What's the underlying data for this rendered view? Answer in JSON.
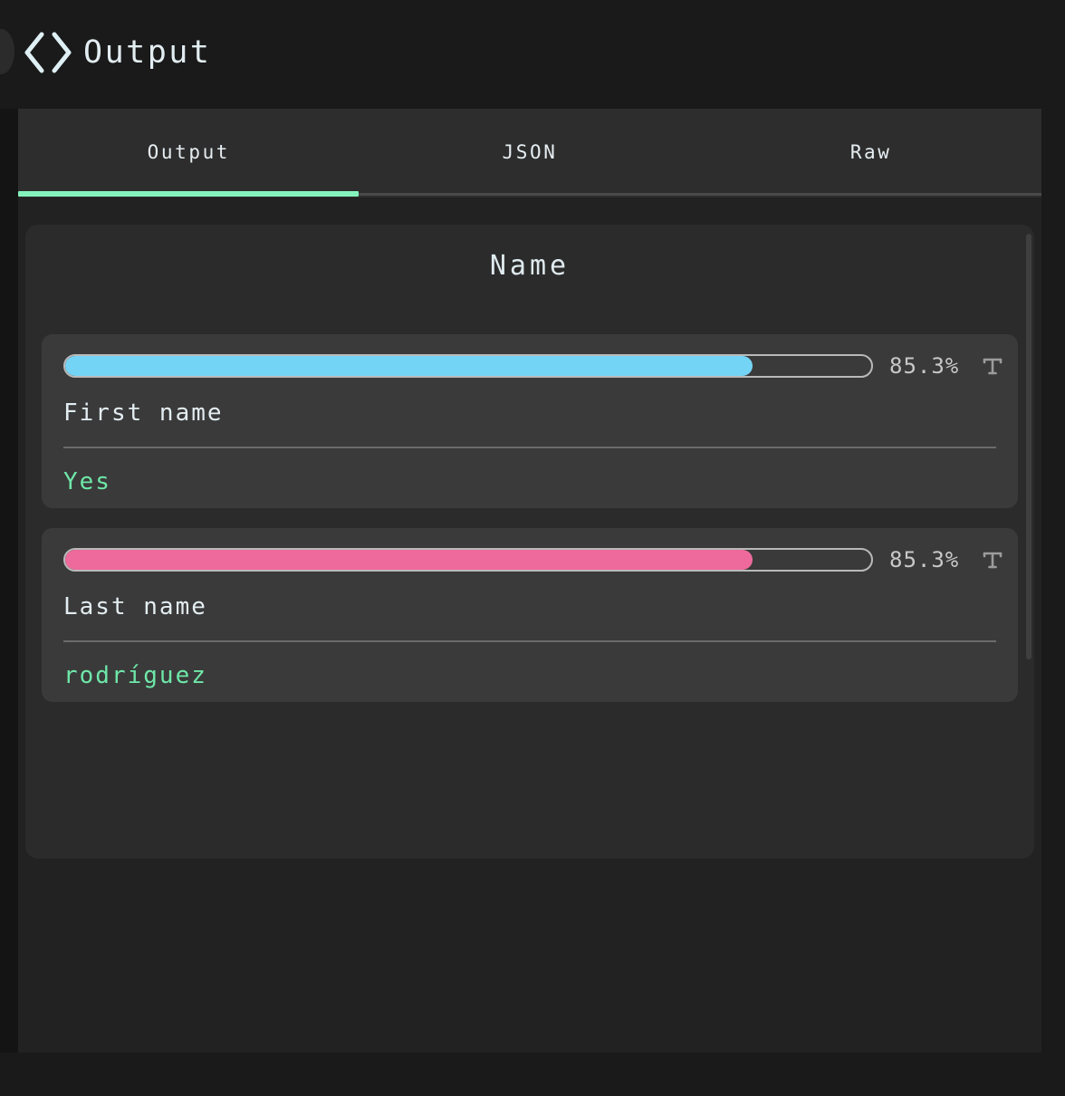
{
  "header": {
    "title": "Output",
    "code_icon": "code-brackets-icon"
  },
  "tabs": [
    {
      "label": "Output",
      "active": true
    },
    {
      "label": "JSON",
      "active": false
    },
    {
      "label": "Raw",
      "active": false
    }
  ],
  "content": {
    "group_title": "Name",
    "fields": [
      {
        "label": "First name",
        "value": "Yes",
        "confidence_pct": "85.3%",
        "confidence_value": 85.3,
        "bar_color": "#74d4f5",
        "type_icon": "text-type-icon"
      },
      {
        "label": "Last name",
        "value": "rodríguez",
        "confidence_pct": "85.3%",
        "confidence_value": 85.3,
        "bar_color": "#ee6a9c",
        "type_icon": "text-type-icon"
      }
    ]
  },
  "colors": {
    "accent_green": "#84f2bb",
    "value_green": "#6ee7a8",
    "bar_blue": "#74d4f5",
    "bar_pink": "#ee6a9c",
    "panel_bg": "#222222",
    "card_bg": "#3a3a3a",
    "text_light": "#e3edf1"
  }
}
